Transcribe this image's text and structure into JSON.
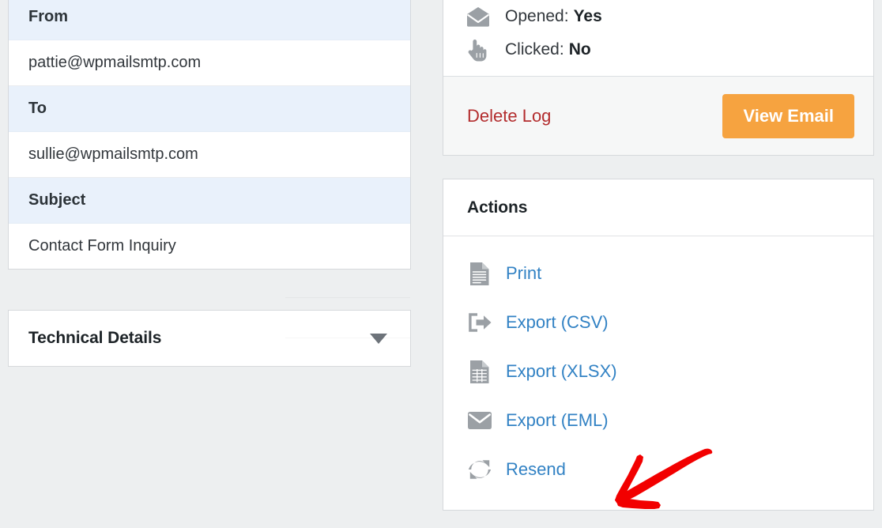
{
  "email_details": {
    "rows": [
      {
        "label": "From",
        "value": "pattie@wpmailsmtp.com"
      },
      {
        "label": "To",
        "value": "sullie@wpmailsmtp.com"
      },
      {
        "label": "Subject",
        "value": "Contact Form Inquiry"
      }
    ]
  },
  "technical_details": {
    "title": "Technical Details",
    "toggle_icon": "chevron-down-icon"
  },
  "status": {
    "items": [
      {
        "icon": "envelope-open-icon",
        "label": "Opened:",
        "value": "Yes"
      },
      {
        "icon": "pointing-hand-icon",
        "label": "Clicked:",
        "value": "No"
      }
    ],
    "delete_log_label": "Delete Log",
    "view_email_label": "View Email"
  },
  "actions": {
    "title": "Actions",
    "items": [
      {
        "icon": "document-icon",
        "label": "Print"
      },
      {
        "icon": "export-arrow-icon",
        "label": "Export (CSV)"
      },
      {
        "icon": "spreadsheet-icon",
        "label": "Export (XLSX)"
      },
      {
        "icon": "envelope-icon",
        "label": "Export (EML)"
      },
      {
        "icon": "refresh-icon",
        "label": "Resend"
      }
    ]
  },
  "annotation": {
    "type": "arrow",
    "color": "#f20000",
    "points_to": "Resend"
  },
  "colors": {
    "page_background": "#edeff0",
    "panel_background": "#ffffff",
    "header_row_background": "#e9f1fb",
    "link_blue": "#3282c4",
    "danger_red": "#b32d2e",
    "accent_orange": "#f6a340",
    "border": "#d6d9dc",
    "text_dark": "#1d2327",
    "icon_grey": "#9ba0a5",
    "annotation_red": "#f20000"
  }
}
